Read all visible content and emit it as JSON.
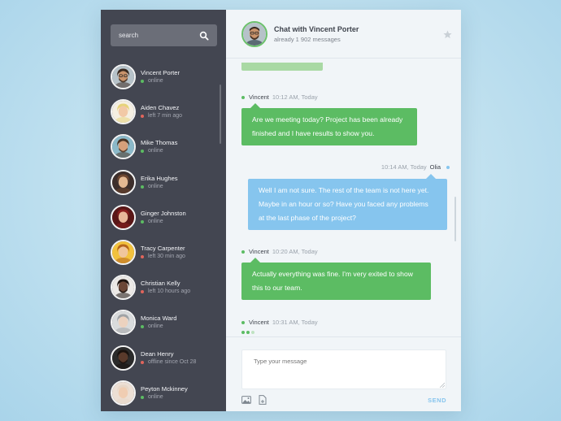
{
  "colors": {
    "online": "#5cbc63",
    "away": "#e0655c",
    "accent_green": "#5cbc63",
    "accent_blue": "#86c5ee",
    "sidebar": "#434651"
  },
  "sidebar": {
    "search": {
      "placeholder": "search",
      "icon": "search-icon"
    },
    "contacts": [
      {
        "name": "Vincent Porter",
        "status": "online",
        "state": "online",
        "skin": "#c9936b",
        "hair": "#3a2a20",
        "bg": "#b6c2c9",
        "glasses": true,
        "beard": true
      },
      {
        "name": "Aiden Chavez",
        "status": "left 7 min ago",
        "state": "away",
        "skin": "#f2c9a6",
        "hair": "#e6d37a",
        "bg": "#f5efe2",
        "glasses": false,
        "beard": false
      },
      {
        "name": "Mike Thomas",
        "status": "online",
        "state": "online",
        "skin": "#d7a07a",
        "hair": "#4a3424",
        "bg": "#8bb9c9",
        "glasses": false,
        "beard": true
      },
      {
        "name": "Erika Hughes",
        "status": "online",
        "state": "online",
        "skin": "#e4b892",
        "hair": "#6e4630",
        "bg": "#3e2f2c",
        "glasses": false,
        "beard": false
      },
      {
        "name": "Ginger Johnston",
        "status": "online",
        "state": "online",
        "skin": "#e8b79a",
        "hair": "#8a1f1f",
        "bg": "#5a1717",
        "glasses": false,
        "beard": false
      },
      {
        "name": "Tracy Carpenter",
        "status": "left 30 min ago",
        "state": "away",
        "skin": "#f0c69c",
        "hair": "#b5651d",
        "bg": "#f2c23e",
        "glasses": false,
        "beard": false
      },
      {
        "name": "Christian Kelly",
        "status": "left 10 hours ago",
        "state": "away",
        "skin": "#6b4636",
        "hair": "#1e1410",
        "bg": "#ece9e6",
        "glasses": false,
        "beard": true
      },
      {
        "name": "Monica Ward",
        "status": "online",
        "state": "online",
        "skin": "#ecd2bf",
        "hair": "#a0a3a6",
        "bg": "#d9dbdc",
        "glasses": false,
        "beard": false
      },
      {
        "name": "Dean Henry",
        "status": "offline since Oct 28",
        "state": "away",
        "skin": "#5a3a2b",
        "hair": "#1a120e",
        "bg": "#2b2b2b",
        "glasses": false,
        "beard": true
      },
      {
        "name": "Peyton Mckinney",
        "status": "online",
        "state": "online",
        "skin": "#f0cdb2",
        "hair": "#e7d7c8",
        "bg": "#ecdfd4",
        "glasses": false,
        "beard": false
      }
    ]
  },
  "chat": {
    "title": "Chat with Vincent Porter",
    "subtitle": "already 1 902 messages",
    "star_icon": "star-icon",
    "messages": [
      {
        "author": "Vincent",
        "time": "10:12 AM, Today",
        "side": "left",
        "text": [
          "Are we meeting today? Project has been already",
          "finished and I have results to show you."
        ]
      },
      {
        "author": "Olia",
        "time": "10:14 AM, Today",
        "side": "right",
        "text": [
          "Well I am not sure. The rest of the team is not here yet.",
          "Maybe  in an hour or so?  Have you faced any problems",
          "at the last phase of the project?"
        ]
      },
      {
        "author": "Vincent",
        "time": "10:20 AM, Today",
        "side": "left",
        "text": [
          "Actually everything was fine. I'm very exited to show",
          "this to our team."
        ]
      },
      {
        "author": "Vincent",
        "time": "10:31 AM, Today",
        "side": "left",
        "typing": true
      }
    ]
  },
  "composer": {
    "placeholder": "Type your message",
    "send_label": "SEND",
    "image_icon": "image-icon",
    "file_icon": "file-icon"
  }
}
